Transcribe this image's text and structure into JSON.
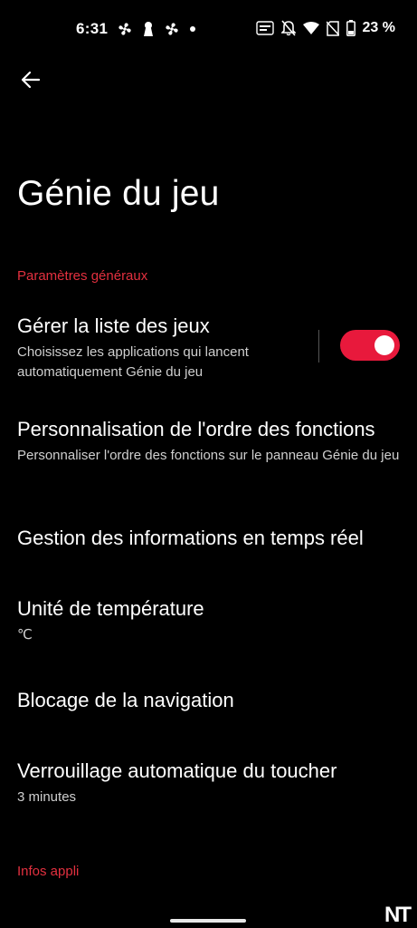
{
  "status_bar": {
    "time": "6:31",
    "battery_percent": "23 %"
  },
  "page": {
    "title": "Génie du jeu"
  },
  "sections": {
    "general_header": "Paramètres généraux",
    "app_info_header": "Infos appli"
  },
  "items": {
    "game_list": {
      "title": "Gérer la liste des jeux",
      "subtitle": "Choisissez les applications qui lancent automatiquement Génie du jeu",
      "toggle_on": true
    },
    "function_order": {
      "title": "Personnalisation de l'ordre des fonctions",
      "subtitle": "Personnaliser l'ordre des fonctions sur le panneau Génie du jeu"
    },
    "realtime_info": {
      "title": "Gestion des informations en temps réel"
    },
    "temperature_unit": {
      "title": "Unité de température",
      "subtitle": "℃"
    },
    "navigation_lock": {
      "title": "Blocage de la navigation"
    },
    "touch_autolock": {
      "title": "Verrouillage automatique du toucher",
      "subtitle": "3 minutes"
    }
  },
  "colors": {
    "accent": "#e3303f",
    "toggle_on": "#e8193c",
    "background": "#000000"
  },
  "watermark": "NT"
}
